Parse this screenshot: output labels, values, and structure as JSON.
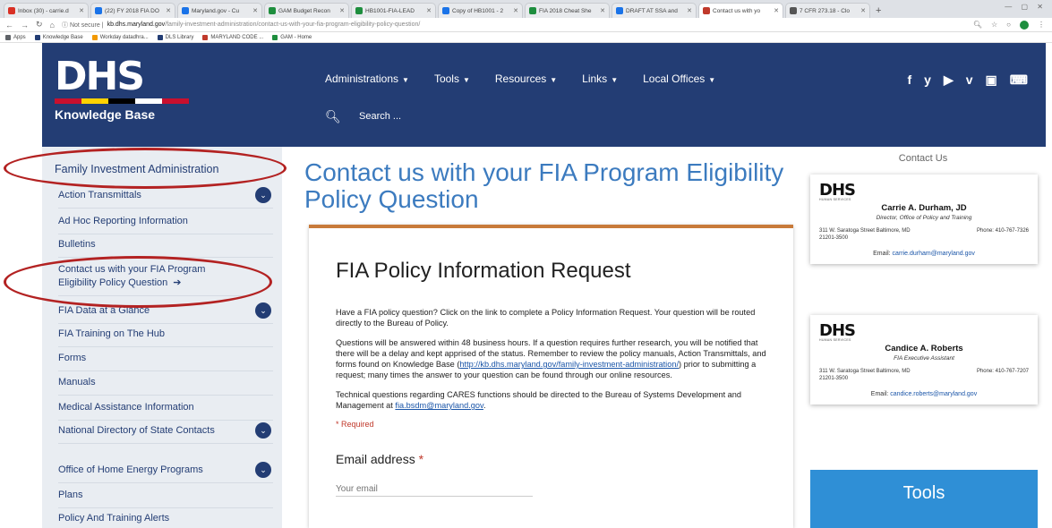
{
  "browser": {
    "tabs": [
      {
        "label": "Inbox (30) - carrie.d",
        "color": "#d93025",
        "active": false
      },
      {
        "label": "(22) FY 2018 FIA DO",
        "color": "#1a73e8",
        "active": false
      },
      {
        "label": "Maryland.gov - Cu",
        "color": "#1a73e8",
        "active": false
      },
      {
        "label": "GAM Budget Recon",
        "color": "#1e8e3e",
        "active": false
      },
      {
        "label": "HB1001-FIA-LEAD",
        "color": "#1e8e3e",
        "active": false
      },
      {
        "label": "Copy of HB1001 - 2",
        "color": "#1a73e8",
        "active": false
      },
      {
        "label": "FIA 2018 Cheat She",
        "color": "#1e8e3e",
        "active": false
      },
      {
        "label": "DRAFT AT SSA and",
        "color": "#1a73e8",
        "active": false
      },
      {
        "label": "Contact us with yo",
        "color": "#c0392b",
        "active": true
      },
      {
        "label": "7 CFR 273.18 - Clo",
        "color": "#555555",
        "active": false
      }
    ],
    "url_security": "Not secure",
    "url_host": "kb.dhs.maryland.gov",
    "url_path": "/family-investment-administration/contact-us-with-your-fia-program-eligibility-policy-question/",
    "bookmarks": [
      {
        "label": "Apps",
        "color": "#5f6368"
      },
      {
        "label": "Knowledge Base",
        "color": "#233d74"
      },
      {
        "label": "Workday datadhra...",
        "color": "#f29900"
      },
      {
        "label": "DLS Library",
        "color": "#233d74"
      },
      {
        "label": "MARYLAND CODE ...",
        "color": "#c0392b"
      },
      {
        "label": "GAM - Home",
        "color": "#1e8e3e"
      }
    ]
  },
  "header": {
    "logo_text": "DHS",
    "logo_subtitle": "Knowledge Base",
    "nav": [
      "Administrations",
      "Tools",
      "Resources",
      "Links",
      "Local Offices"
    ],
    "search_placeholder": "Search ...",
    "socials": [
      "f",
      "y",
      "▶",
      "v",
      "▣",
      "⌨"
    ]
  },
  "sidebar": {
    "heading": "Family Investment Administration",
    "items": [
      {
        "label": "Action Transmittals",
        "expandable": true
      },
      {
        "label": "Ad Hoc Reporting Information",
        "expandable": false
      },
      {
        "label": "Bulletins",
        "expandable": false
      },
      {
        "label": "Contact us with your FIA Program Eligibility Policy Question",
        "expandable": false,
        "current": true
      },
      {
        "label": "FIA Data at a Glance",
        "expandable": true
      },
      {
        "label": "FIA Training on The Hub",
        "expandable": false
      },
      {
        "label": "Forms",
        "expandable": false
      },
      {
        "label": "Manuals",
        "expandable": false
      },
      {
        "label": "Medical Assistance Information",
        "expandable": false
      },
      {
        "label": "National Directory of State Contacts",
        "expandable": true
      },
      {
        "label": "Office of Home Energy Programs",
        "expandable": true
      },
      {
        "label": "Plans",
        "expandable": false
      },
      {
        "label": "Policy And Training Alerts",
        "expandable": false
      }
    ]
  },
  "main": {
    "page_title": "Contact us with your FIA Program Eligibility Policy Question",
    "form_title": "FIA Policy Information Request",
    "para1": "Have a FIA policy question? Click on the link to complete a Policy Information Request. Your question will be routed directly to the Bureau of Policy.",
    "para2_a": "Questions will be answered within 48 business hours. If a question requires further research, you will be notified that there will be a delay and kept apprised of the status. Remember to review the policy manuals, Action Transmittals, and forms found on Knowledge Base (",
    "para2_link": "http://kb.dhs.maryland.gov/family-investment-administration/",
    "para2_b": ") prior to submitting a request; many times the answer to your question can be found through our online resources.",
    "para3_a": "Technical questions regarding CARES functions should be directed to the Bureau of Systems Development and Management at ",
    "para3_link": "fia.bsdm@maryland.gov",
    "para3_b": ".",
    "required_note": "* Required",
    "email_label": "Email address",
    "email_required_mark": "*",
    "email_placeholder": "Your email"
  },
  "right": {
    "contact_heading": "Contact Us",
    "cards": [
      {
        "logo": "DHS",
        "logo_sub": "HUMAN SERVICES",
        "name": "Carrie A. Durham, JD",
        "title": "Director, Office of Policy and Training",
        "address": "311 W. Saratoga Street Baltimore, MD 21201-3500",
        "phone": "Phone: 410-767-7326",
        "email_label": "Email:",
        "email": "carrie.durham@maryland.gov"
      },
      {
        "logo": "DHS",
        "logo_sub": "HUMAN SERVICES",
        "name": "Candice A. Roberts",
        "title": "FIA Executive Assistant",
        "address": "311 W. Saratoga Street Baltimore, MD 21201-3500",
        "phone": "Phone: 410-767-7207",
        "email_label": "Email:",
        "email": "candice.roberts@maryland.gov"
      }
    ],
    "tools_label": "Tools"
  }
}
